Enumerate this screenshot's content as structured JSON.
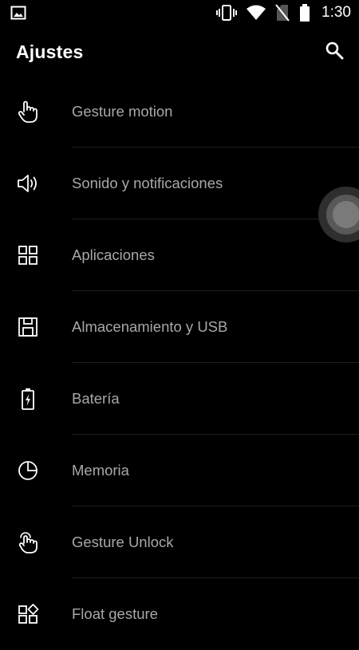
{
  "status_bar": {
    "time": "1:30",
    "icons": [
      "image-icon",
      "vibrate-icon",
      "wifi-icon",
      "no-sim-icon",
      "battery-icon"
    ]
  },
  "header": {
    "title": "Ajustes",
    "search_icon": "search-icon"
  },
  "settings": {
    "items": [
      {
        "label": "Gesture motion",
        "icon": "hand-pointer-icon"
      },
      {
        "label": "Sonido y notificaciones",
        "icon": "speaker-icon"
      },
      {
        "label": "Aplicaciones",
        "icon": "apps-grid-icon"
      },
      {
        "label": "Almacenamiento y USB",
        "icon": "storage-icon"
      },
      {
        "label": "Batería",
        "icon": "battery-charging-icon"
      },
      {
        "label": "Memoria",
        "icon": "memory-pie-icon"
      },
      {
        "label": "Gesture Unlock",
        "icon": "hand-tap-icon"
      },
      {
        "label": "Float gesture",
        "icon": "float-grid-icon"
      }
    ]
  },
  "colors": {
    "background": "#000000",
    "title": "#ffffff",
    "item_text": "#a8a8a8",
    "divider": "#1f1f1f",
    "floating_ball": "#585858"
  }
}
